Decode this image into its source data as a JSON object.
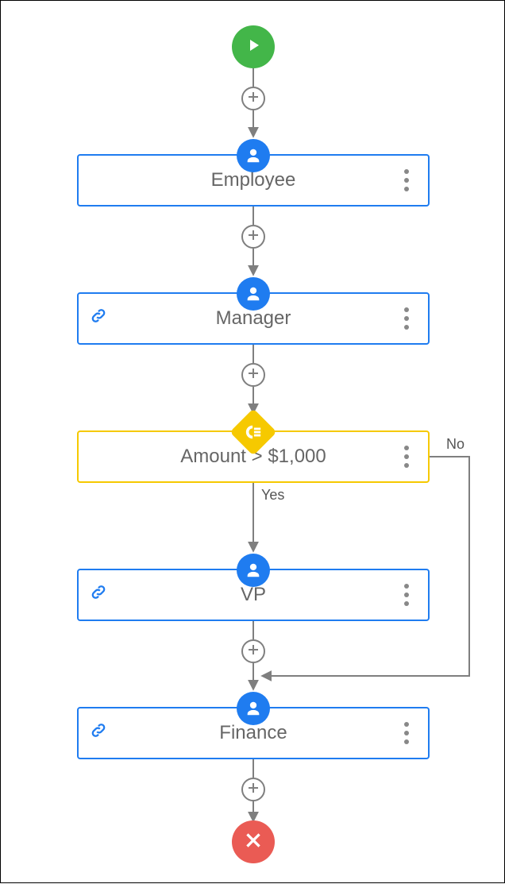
{
  "workflow": {
    "steps": {
      "employee": {
        "label": "Employee"
      },
      "manager": {
        "label": "Manager"
      },
      "decision": {
        "label": "Amount > $1,000"
      },
      "vp": {
        "label": "VP"
      },
      "finance": {
        "label": "Finance"
      }
    },
    "edges": {
      "yes": "Yes",
      "no": "No"
    }
  },
  "colors": {
    "start": "#43b649",
    "end": "#ea5b54",
    "user": "#1f7cf0",
    "decision": "#f6c900"
  }
}
